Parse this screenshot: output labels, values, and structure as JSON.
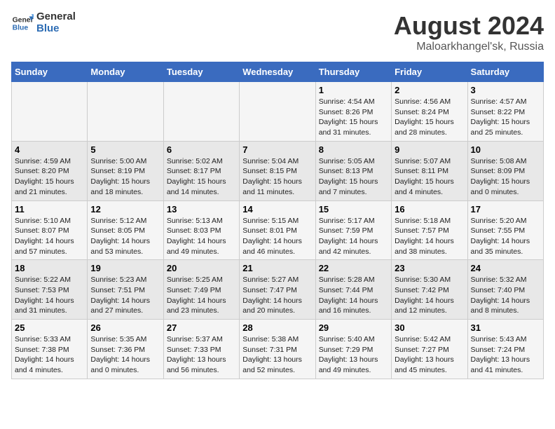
{
  "header": {
    "logo_general": "General",
    "logo_blue": "Blue",
    "main_title": "August 2024",
    "subtitle": "Maloarkhangel'sk, Russia"
  },
  "weekdays": [
    "Sunday",
    "Monday",
    "Tuesday",
    "Wednesday",
    "Thursday",
    "Friday",
    "Saturday"
  ],
  "weeks": [
    [
      {
        "day": "",
        "sunrise": "",
        "sunset": "",
        "daylight": ""
      },
      {
        "day": "",
        "sunrise": "",
        "sunset": "",
        "daylight": ""
      },
      {
        "day": "",
        "sunrise": "",
        "sunset": "",
        "daylight": ""
      },
      {
        "day": "",
        "sunrise": "",
        "sunset": "",
        "daylight": ""
      },
      {
        "day": "1",
        "sunrise": "4:54 AM",
        "sunset": "8:26 PM",
        "daylight": "15 hours and 31 minutes."
      },
      {
        "day": "2",
        "sunrise": "4:56 AM",
        "sunset": "8:24 PM",
        "daylight": "15 hours and 28 minutes."
      },
      {
        "day": "3",
        "sunrise": "4:57 AM",
        "sunset": "8:22 PM",
        "daylight": "15 hours and 25 minutes."
      }
    ],
    [
      {
        "day": "4",
        "sunrise": "4:59 AM",
        "sunset": "8:20 PM",
        "daylight": "15 hours and 21 minutes."
      },
      {
        "day": "5",
        "sunrise": "5:00 AM",
        "sunset": "8:19 PM",
        "daylight": "15 hours and 18 minutes."
      },
      {
        "day": "6",
        "sunrise": "5:02 AM",
        "sunset": "8:17 PM",
        "daylight": "15 hours and 14 minutes."
      },
      {
        "day": "7",
        "sunrise": "5:04 AM",
        "sunset": "8:15 PM",
        "daylight": "15 hours and 11 minutes."
      },
      {
        "day": "8",
        "sunrise": "5:05 AM",
        "sunset": "8:13 PM",
        "daylight": "15 hours and 7 minutes."
      },
      {
        "day": "9",
        "sunrise": "5:07 AM",
        "sunset": "8:11 PM",
        "daylight": "15 hours and 4 minutes."
      },
      {
        "day": "10",
        "sunrise": "5:08 AM",
        "sunset": "8:09 PM",
        "daylight": "15 hours and 0 minutes."
      }
    ],
    [
      {
        "day": "11",
        "sunrise": "5:10 AM",
        "sunset": "8:07 PM",
        "daylight": "14 hours and 57 minutes."
      },
      {
        "day": "12",
        "sunrise": "5:12 AM",
        "sunset": "8:05 PM",
        "daylight": "14 hours and 53 minutes."
      },
      {
        "day": "13",
        "sunrise": "5:13 AM",
        "sunset": "8:03 PM",
        "daylight": "14 hours and 49 minutes."
      },
      {
        "day": "14",
        "sunrise": "5:15 AM",
        "sunset": "8:01 PM",
        "daylight": "14 hours and 46 minutes."
      },
      {
        "day": "15",
        "sunrise": "5:17 AM",
        "sunset": "7:59 PM",
        "daylight": "14 hours and 42 minutes."
      },
      {
        "day": "16",
        "sunrise": "5:18 AM",
        "sunset": "7:57 PM",
        "daylight": "14 hours and 38 minutes."
      },
      {
        "day": "17",
        "sunrise": "5:20 AM",
        "sunset": "7:55 PM",
        "daylight": "14 hours and 35 minutes."
      }
    ],
    [
      {
        "day": "18",
        "sunrise": "5:22 AM",
        "sunset": "7:53 PM",
        "daylight": "14 hours and 31 minutes."
      },
      {
        "day": "19",
        "sunrise": "5:23 AM",
        "sunset": "7:51 PM",
        "daylight": "14 hours and 27 minutes."
      },
      {
        "day": "20",
        "sunrise": "5:25 AM",
        "sunset": "7:49 PM",
        "daylight": "14 hours and 23 minutes."
      },
      {
        "day": "21",
        "sunrise": "5:27 AM",
        "sunset": "7:47 PM",
        "daylight": "14 hours and 20 minutes."
      },
      {
        "day": "22",
        "sunrise": "5:28 AM",
        "sunset": "7:44 PM",
        "daylight": "14 hours and 16 minutes."
      },
      {
        "day": "23",
        "sunrise": "5:30 AM",
        "sunset": "7:42 PM",
        "daylight": "14 hours and 12 minutes."
      },
      {
        "day": "24",
        "sunrise": "5:32 AM",
        "sunset": "7:40 PM",
        "daylight": "14 hours and 8 minutes."
      }
    ],
    [
      {
        "day": "25",
        "sunrise": "5:33 AM",
        "sunset": "7:38 PM",
        "daylight": "14 hours and 4 minutes."
      },
      {
        "day": "26",
        "sunrise": "5:35 AM",
        "sunset": "7:36 PM",
        "daylight": "14 hours and 0 minutes."
      },
      {
        "day": "27",
        "sunrise": "5:37 AM",
        "sunset": "7:33 PM",
        "daylight": "13 hours and 56 minutes."
      },
      {
        "day": "28",
        "sunrise": "5:38 AM",
        "sunset": "7:31 PM",
        "daylight": "13 hours and 52 minutes."
      },
      {
        "day": "29",
        "sunrise": "5:40 AM",
        "sunset": "7:29 PM",
        "daylight": "13 hours and 49 minutes."
      },
      {
        "day": "30",
        "sunrise": "5:42 AM",
        "sunset": "7:27 PM",
        "daylight": "13 hours and 45 minutes."
      },
      {
        "day": "31",
        "sunrise": "5:43 AM",
        "sunset": "7:24 PM",
        "daylight": "13 hours and 41 minutes."
      }
    ]
  ]
}
